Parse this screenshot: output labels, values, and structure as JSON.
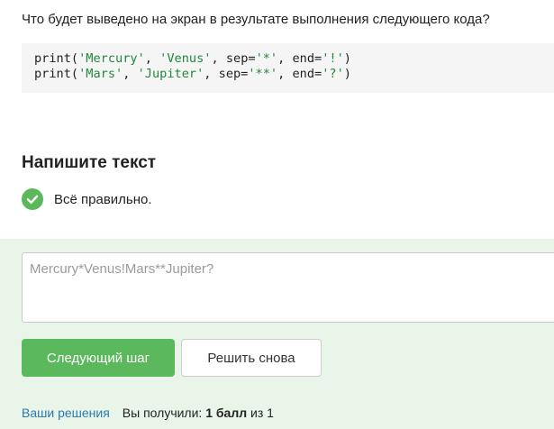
{
  "question": {
    "text": "Что будет выведено на экран в результате выполнения следующего кода?"
  },
  "code": {
    "lines": [
      {
        "p1": "print(",
        "s1": "'Mercury'",
        "p2": ", ",
        "s2": "'Venus'",
        "p3": ", sep=",
        "s3": "'*'",
        "p4": ", end=",
        "s4": "'!'",
        "p5": ")"
      },
      {
        "p1": "print(",
        "s1": "'Mars'",
        "p2": ", ",
        "s2": "'Jupiter'",
        "p3": ", sep=",
        "s3": "'**'",
        "p4": ", end=",
        "s4": "'?'",
        "p5": ")"
      }
    ]
  },
  "task": {
    "title": "Напишите текст"
  },
  "status": {
    "text": "Всё правильно.",
    "icon": "check-circle-icon",
    "color": "#5cb85c"
  },
  "answer": {
    "value": "Mercury*Venus!Mars**Jupiter?"
  },
  "actions": {
    "next_label": "Следующий шаг",
    "retry_label": "Решить снова"
  },
  "footer": {
    "solutions_link": "Ваши решения",
    "score_prefix": "Вы получили: ",
    "score_value": "1 балл",
    "score_suffix": " из 1"
  },
  "colors": {
    "accent_green": "#5cb85c",
    "answer_bg": "#e9f5e9",
    "code_bg": "#f5f5f5",
    "code_string": "#22863a",
    "link": "#2a7ab0"
  }
}
